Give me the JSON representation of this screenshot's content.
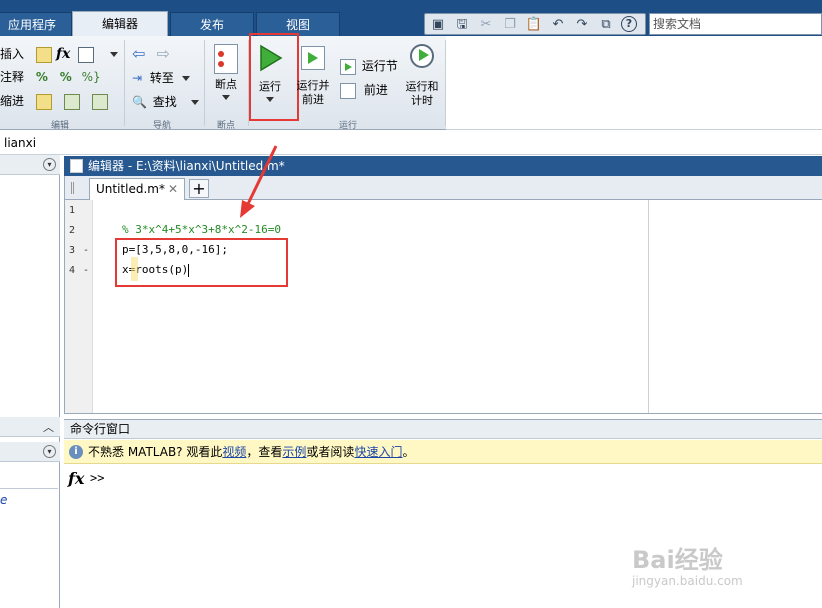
{
  "tabs": [
    {
      "label": "应用程序",
      "active": false
    },
    {
      "label": "编辑器",
      "active": true
    },
    {
      "label": "发布",
      "active": false
    },
    {
      "label": "视图",
      "active": false
    }
  ],
  "search": {
    "placeholder": "搜索文档"
  },
  "ribbon": {
    "edit": {
      "insert": "插入",
      "comment": "注释",
      "indent": "缩进",
      "fx": "fx",
      "section_label": "编辑"
    },
    "navigate": {
      "goto": "转至",
      "find": "查找",
      "section_label": "导航"
    },
    "breakpoints": {
      "label": "断点",
      "section_label": "断点"
    },
    "run": {
      "run": "运行",
      "run_advance_1": "运行并",
      "run_advance_2": "前进",
      "run_section": "运行节",
      "advance": "前进",
      "run_time_1": "运行和",
      "run_time_2": "计时",
      "section_label": "运行"
    }
  },
  "current_folder": "lianxi",
  "editor": {
    "title": "编辑器 - E:\\资料\\lianxi\\Untitled.m*",
    "tab": "Untitled.m*",
    "lines": [
      {
        "num": "1",
        "dash": "",
        "text": ""
      },
      {
        "num": "2",
        "dash": "",
        "text": "% 3*x^4+5*x^3+8*x^2-16=0"
      },
      {
        "num": "3",
        "dash": "-",
        "text": "p=[3,5,8,0,-16];"
      },
      {
        "num": "4",
        "dash": "-",
        "text": "x=roots(p)"
      }
    ]
  },
  "command_window": {
    "title": "命令行窗口",
    "info_prefix": "不熟悉 MATLAB? 观看此",
    "link_video": "视频",
    "info_mid": "，查看",
    "link_examples": "示例",
    "info_mid2": "或者阅读",
    "link_getting_started": "快速入门",
    "info_suffix": "。",
    "prompt": ">>"
  },
  "left_panel": {
    "italic_fragment": "e"
  },
  "watermark": {
    "brand": "Bai经验",
    "url": "jingyan.baidu.com"
  },
  "colors": {
    "title_bar": "#1d4f86",
    "highlight": "#e53935",
    "comment": "#228b22",
    "run_icon": "#3fae3a"
  }
}
